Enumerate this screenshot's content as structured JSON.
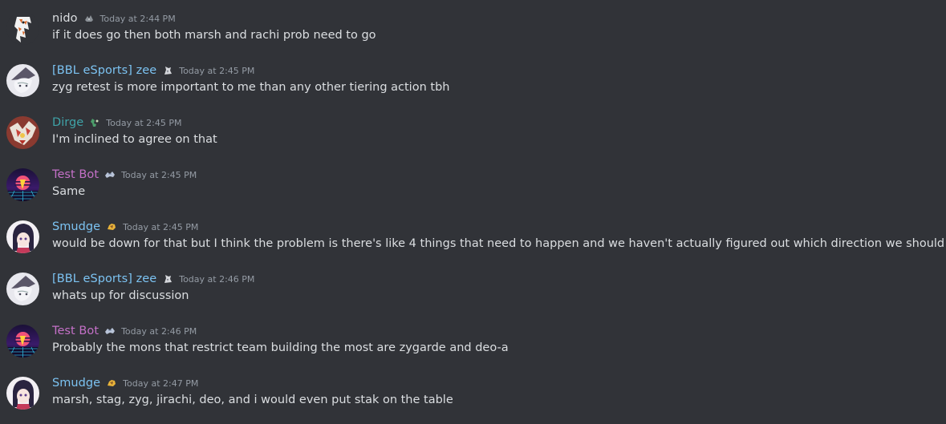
{
  "colors": {
    "background": "#313338",
    "message_text": "#dbdee1",
    "timestamp": "#949ba4",
    "role_default": "#dbdee1",
    "role_blue": "#7cc3f2",
    "role_teal": "#3fa3a8",
    "role_pink": "#c470c7"
  },
  "messages": [
    {
      "username": "nido",
      "badge_icon": "pokemon-icon",
      "timestamp": "Today at 2:44 PM",
      "text": "if it does go then both marsh and rachi prob need to go"
    },
    {
      "username": "[BBL eSports] zee",
      "badge_icon": "pokemon-icon",
      "timestamp": "Today at 2:45 PM",
      "text": "zyg retest is more important to me than any other tiering action tbh"
    },
    {
      "username": "Dirge",
      "badge_icon": "pokemon-icon",
      "timestamp": "Today at 2:45 PM",
      "text": "I'm inclined to agree on that"
    },
    {
      "username": "Test Bot",
      "badge_icon": "pokemon-icon",
      "timestamp": "Today at 2:45 PM",
      "text": "Same"
    },
    {
      "username": "Smudge",
      "badge_icon": "pokemon-icon",
      "timestamp": "Today at 2:45 PM",
      "text": "would be down for that but I think the problem is there's like 4 things that need to happen and we haven't actually figured out which direction we should take"
    },
    {
      "username": "[BBL eSports] zee",
      "badge_icon": "pokemon-icon",
      "timestamp": "Today at 2:46 PM",
      "text": "whats up for discussion"
    },
    {
      "username": "Test Bot",
      "badge_icon": "pokemon-icon",
      "timestamp": "Today at 2:46 PM",
      "text": "Probably the mons that restrict team building the most are zygarde and deo-a"
    },
    {
      "username": "Smudge",
      "badge_icon": "pokemon-icon",
      "timestamp": "Today at 2:47 PM",
      "text": "marsh, stag, zyg, jirachi, deo, and i would even put stak on the table"
    }
  ]
}
